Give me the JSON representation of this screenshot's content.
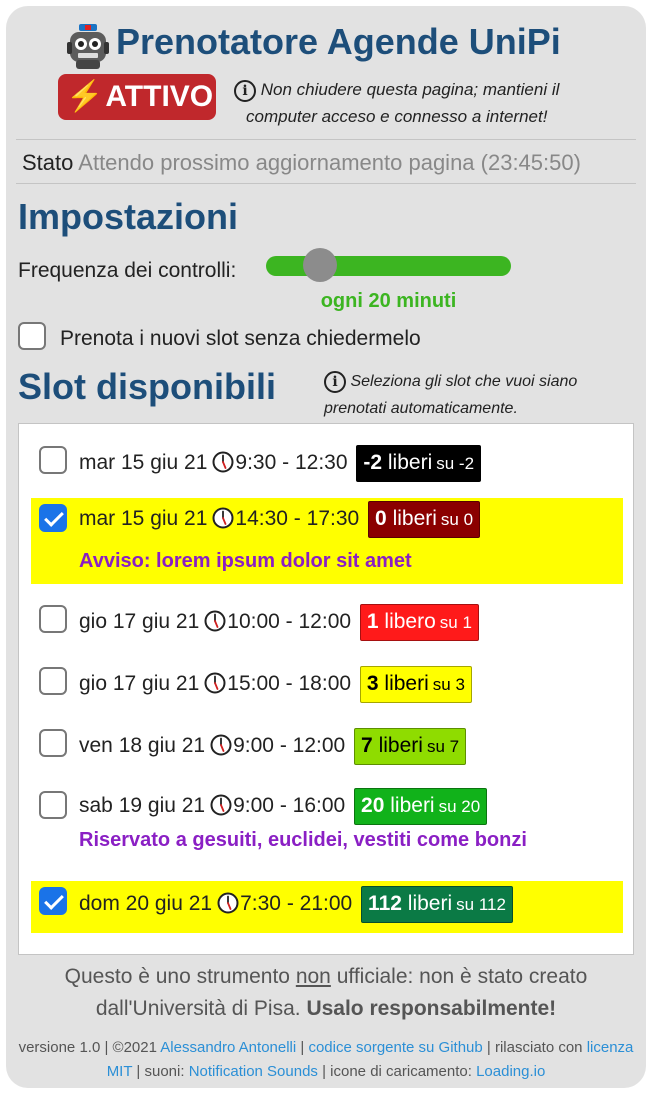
{
  "header": {
    "title": "Prenotatore Agende UniPi",
    "status_label": "ATTIVO",
    "warning_line1": "Non chiudere questa pagina; mantieni il",
    "warning_line2": "computer acceso e connesso a internet!"
  },
  "state": {
    "label": "Stato",
    "value": "Attendo prossimo aggiornamento pagina (23:45:50)"
  },
  "settings": {
    "title": "Impostazioni",
    "frequency_label": "Frequenza dei controlli:",
    "frequency_value": "ogni 20 minuti",
    "slider_fraction": 0.22,
    "auto_book_label": "Prenota i nuovi slot senza chiedermelo",
    "auto_book_checked": false
  },
  "slots_section": {
    "title": "Slot disponibili",
    "note_line1": "Seleziona gli slot che vuoi siano",
    "note_line2": "prenotati automaticamente."
  },
  "slots": [
    {
      "date": "mar 15 giu 21",
      "time": "9:30 - 12:30",
      "free": "-2",
      "free_word": "liberi",
      "total_text": "su -2",
      "selected": false,
      "badge_bg": "#000000",
      "badge_fg": "#ffffff",
      "note": ""
    },
    {
      "date": "mar 15 giu 21",
      "time": "14:30 - 17:30",
      "free": "0",
      "free_word": "liberi",
      "total_text": "su 0",
      "selected": true,
      "badge_bg": "#8b0000",
      "badge_fg": "#ffffff",
      "note": "Avviso: lorem ipsum dolor sit amet"
    },
    {
      "date": "gio 17 giu 21",
      "time": "10:00 - 12:00",
      "free": "1",
      "free_word": "libero",
      "total_text": "su 1",
      "selected": false,
      "badge_bg": "#ff1a1a",
      "badge_fg": "#ffffff",
      "note": ""
    },
    {
      "date": "gio 17 giu 21",
      "time": "15:00 - 18:00",
      "free": "3",
      "free_word": "liberi",
      "total_text": "su 3",
      "selected": false,
      "badge_bg": "#ffff00",
      "badge_fg": "#000000",
      "note": ""
    },
    {
      "date": "ven 18 giu 21",
      "time": "9:00 - 12:00",
      "free": "7",
      "free_word": "liberi",
      "total_text": "su 7",
      "selected": false,
      "badge_bg": "#8fdc00",
      "badge_fg": "#000000",
      "note": ""
    },
    {
      "date": "sab 19 giu 21",
      "time": "9:00 - 16:00",
      "free": "20",
      "free_word": "liberi",
      "total_text": "su 20",
      "selected": false,
      "badge_bg": "#11b21a",
      "badge_fg": "#ffffff",
      "note": "Riservato a gesuiti, euclidei, vestiti come bonzi"
    },
    {
      "date": "dom 20 giu 21",
      "time": "7:30 - 21:00",
      "free": "112",
      "free_word": "liberi",
      "total_text": "su 112",
      "selected": true,
      "badge_bg": "#0b7a45",
      "badge_fg": "#ffffff",
      "note": ""
    }
  ],
  "disclaimer": {
    "part1": "Questo è uno strumento ",
    "underlined": "non",
    "part2": " ufficiale: non è stato creato dall'Università di Pisa. ",
    "bold": "Usalo responsabilmente!"
  },
  "footer": {
    "version": "versione 1.0 | ©2021 ",
    "author": "Alessandro Antonelli",
    "sep1": " | ",
    "source_link": "codice sorgente su Github",
    "released": " | rilasciato con ",
    "license_link": "licenza MIT",
    "sounds": " | suoni: ",
    "sounds_link": "Notification Sounds",
    "icons": " | icone di caricamento: ",
    "icons_link": "Loading.io"
  },
  "colors": {
    "accent_title": "#1d4e7a",
    "active_pill": "#c0282c",
    "slider": "#3cb521",
    "note_purple": "#8a1fc4",
    "selected_row": "#ffff00",
    "link": "#2b8fd6"
  },
  "icons": [
    "robot-icon",
    "lightning-icon",
    "info-icon",
    "clock-icon",
    "checkbox-icon"
  ]
}
